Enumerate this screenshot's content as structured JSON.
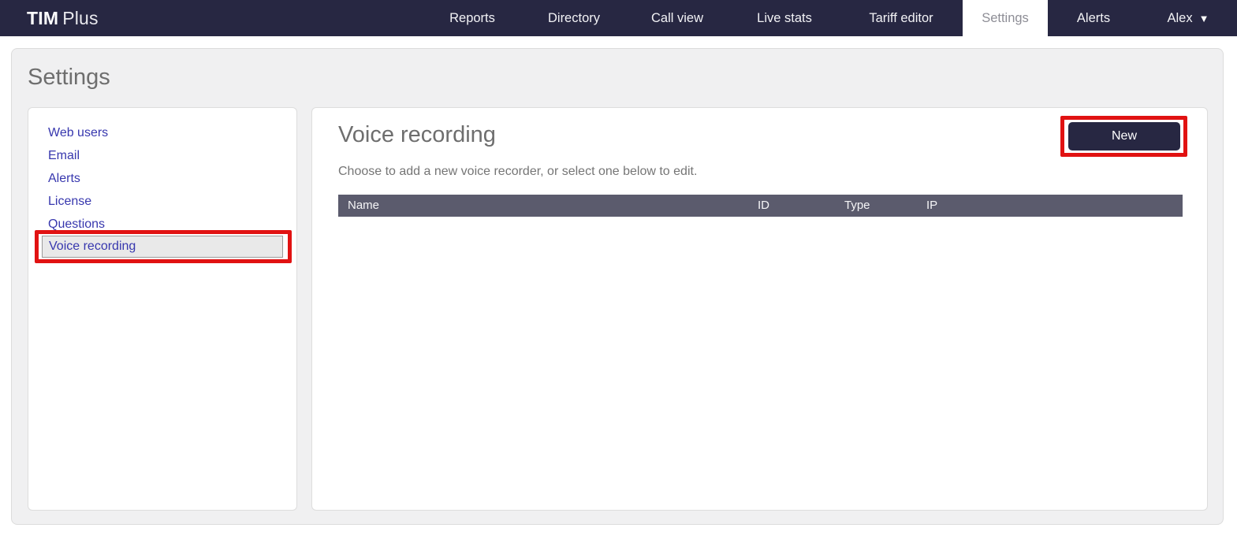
{
  "brand": {
    "name_bold": "TIM",
    "name_light": "Plus"
  },
  "navbar": {
    "items": [
      {
        "label": "Reports",
        "active": false
      },
      {
        "label": "Directory",
        "active": false
      },
      {
        "label": "Call view",
        "active": false
      },
      {
        "label": "Live stats",
        "active": false
      },
      {
        "label": "Tariff editor",
        "active": false
      },
      {
        "label": "Settings",
        "active": true
      },
      {
        "label": "Alerts",
        "active": false
      }
    ],
    "user_menu": {
      "label": "Alex",
      "caret_icon": "▼"
    }
  },
  "page": {
    "title": "Settings"
  },
  "sidebar": {
    "items": [
      {
        "label": "Web users"
      },
      {
        "label": "Email"
      },
      {
        "label": "Alerts"
      },
      {
        "label": "License"
      },
      {
        "label": "Questions"
      }
    ],
    "selected_item": {
      "label": "Voice recording"
    }
  },
  "main": {
    "title": "Voice recording",
    "description": "Choose to add a new voice recorder, or select one below to edit.",
    "new_button_label": "New",
    "table": {
      "columns": [
        "Name",
        "ID",
        "Type",
        "IP"
      ],
      "rows": []
    }
  },
  "colors": {
    "navbar_bg": "#272742",
    "active_tab_bg": "#ffffff",
    "active_tab_text": "#8e8e96",
    "link_color": "#3737ae",
    "annotation_red": "#e11212",
    "table_header_bg": "#5b5b6d",
    "page_bg": "#f0f0f1",
    "heading_gray": "#6e6e6e"
  }
}
